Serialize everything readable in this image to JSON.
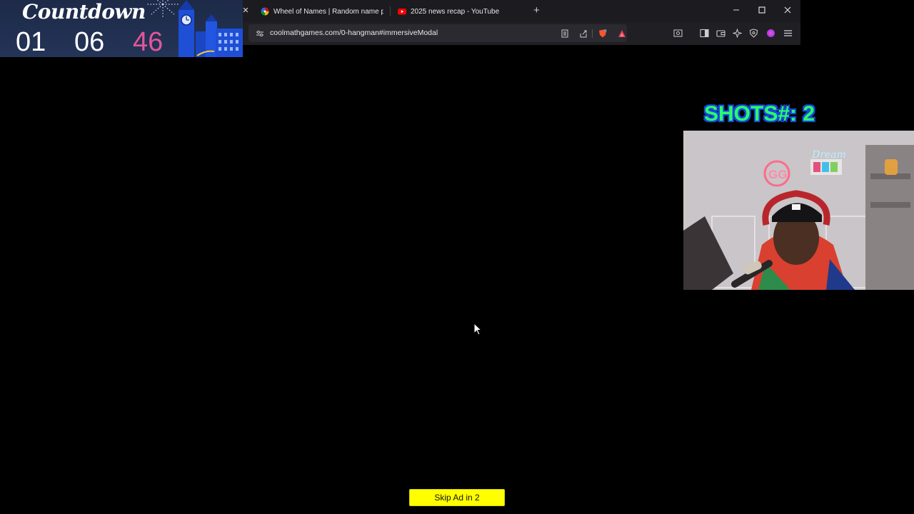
{
  "countdown": {
    "title": "Countdown",
    "hours": "01",
    "minutes": "06",
    "seconds": "46"
  },
  "browser": {
    "tabs": [
      {
        "title": "Wheel of Names | Random name pick",
        "icon": "wheel-favicon"
      },
      {
        "title": "2025 news recap - YouTube",
        "icon": "youtube-favicon"
      }
    ],
    "new_tab_label": "+",
    "url": "coolmathgames.com/0-hangman#immersiveModal"
  },
  "overlay": {
    "shots_label": "SHOTS#: 2"
  },
  "ad": {
    "skip_label": "Skip Ad in 2"
  },
  "colors": {
    "seconds": "#e2569a",
    "shots_text": "#27ff6a",
    "shots_outline": "#1a48d8",
    "skip_button": "#ffff00"
  }
}
